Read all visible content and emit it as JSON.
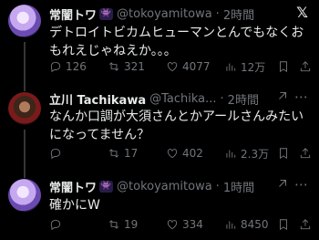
{
  "tweets": [
    {
      "author_name": "常闇トワ",
      "handle": "@tokoyamitowa",
      "time": "2時間",
      "text": "デトロイトビカムヒューマンとんでもなくおもれえじゃねえか。。。",
      "replies": "126",
      "retweets": "321",
      "likes": "4077",
      "views": "12万",
      "verified_badge": "purple-affiliate-badge",
      "top_right": "x-logo-icon",
      "avatar_color": "#8a6ad0"
    },
    {
      "author_name": "立川 Tachikawa",
      "handle": "@Tachika...",
      "time": "2時間",
      "text": "なんか口調が大須さんとかアールさんみたいになってません？",
      "replies": "",
      "retweets": "17",
      "likes": "402",
      "views": "2.3万",
      "top_right": "more-icon",
      "avatar_color": "#7a1a1a"
    },
    {
      "author_name": "常闇トワ",
      "handle": "@tokoyamitowa",
      "time": "1時間",
      "text": "確かにW",
      "replies": "",
      "retweets": "19",
      "likes": "334",
      "views": "8450",
      "verified_badge": "purple-affiliate-badge",
      "top_right": "more-icon",
      "avatar_color": "#8a6ad0"
    }
  ],
  "ui": {
    "dot": "·",
    "x_logo": "𝕏",
    "more": "⋯",
    "badge_glyph": "👾"
  }
}
